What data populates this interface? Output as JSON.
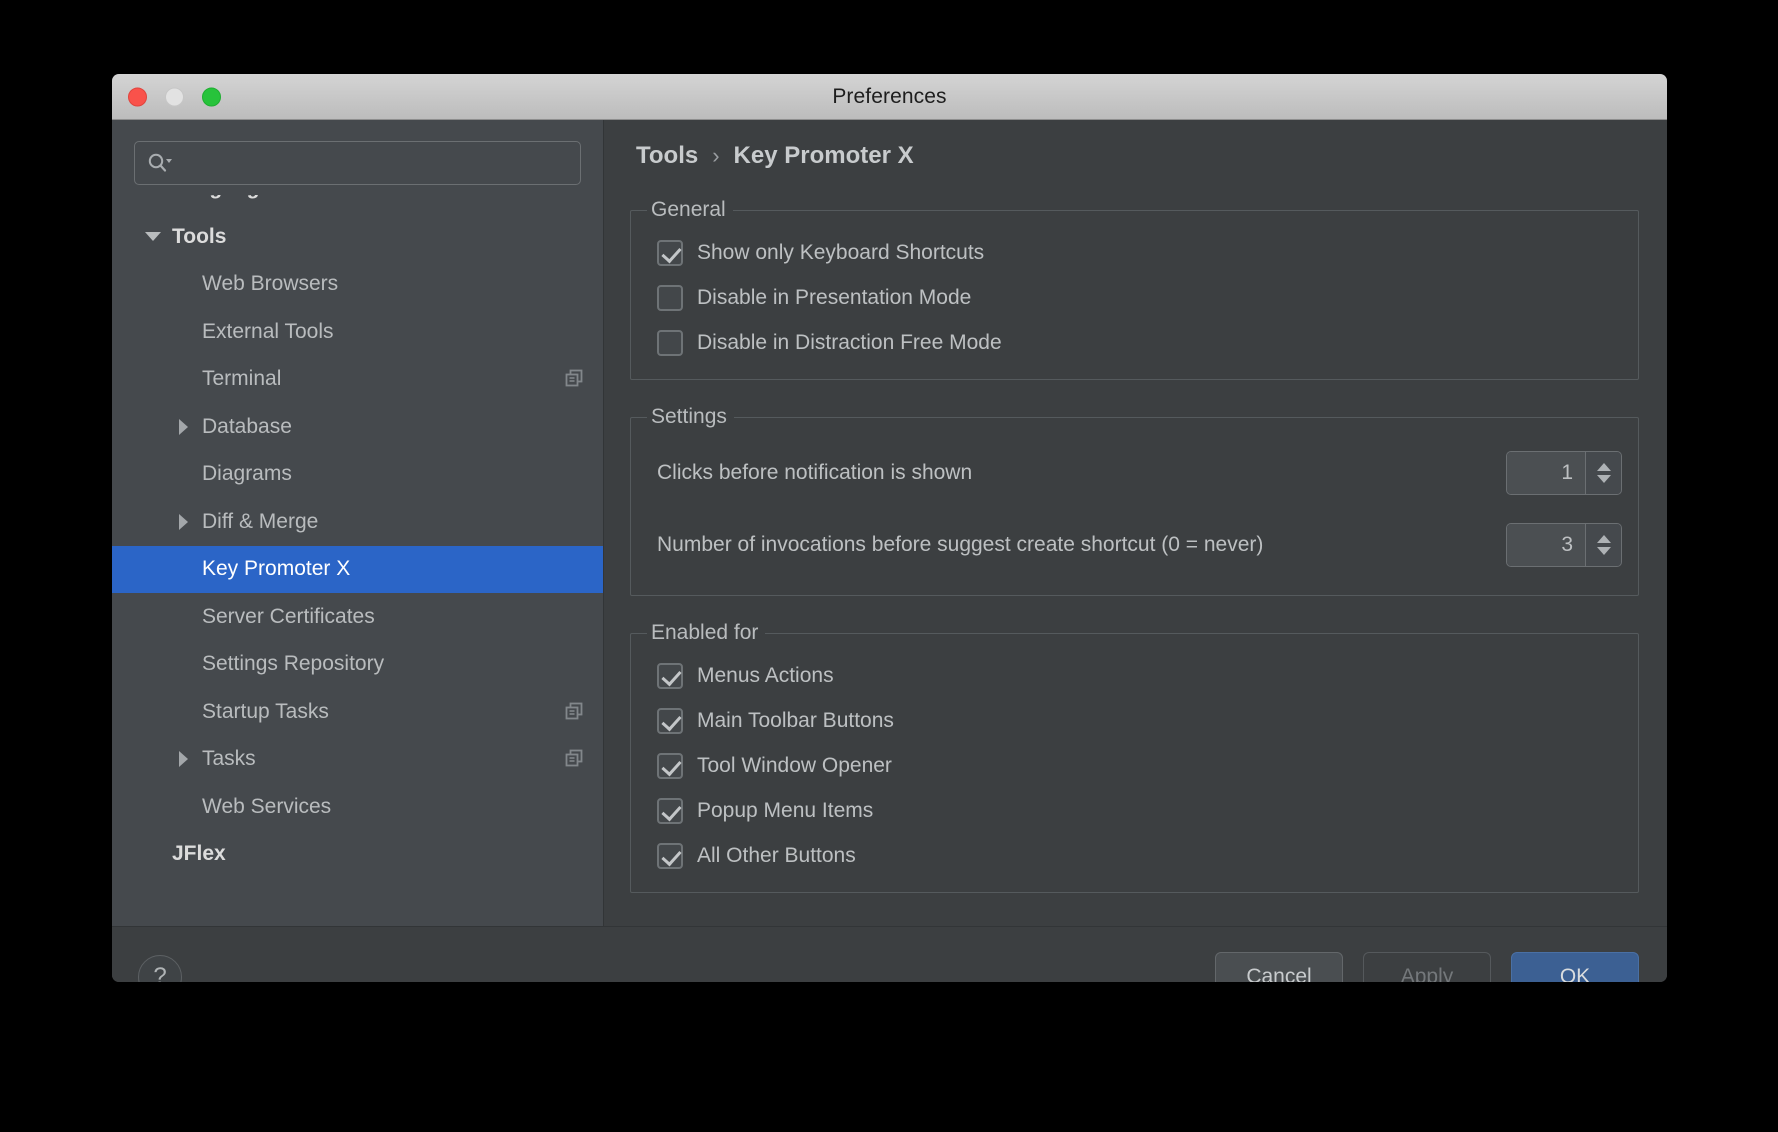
{
  "window": {
    "title": "Preferences",
    "traffic_lights": [
      "close-button",
      "minimize-button",
      "maximize-button"
    ]
  },
  "sidebar": {
    "search": {
      "value": "",
      "placeholder": "",
      "icon": "search-icon"
    },
    "items": [
      {
        "label": "Languages & Frameworks",
        "level": 0,
        "arrow": "none",
        "bold": true,
        "cut": true,
        "selected": false,
        "badge": ""
      },
      {
        "label": "Tools",
        "level": 0,
        "arrow": "down",
        "bold": true,
        "cut": false,
        "selected": false,
        "badge": ""
      },
      {
        "label": "Web Browsers",
        "level": 1,
        "arrow": "none",
        "bold": false,
        "cut": false,
        "selected": false,
        "badge": ""
      },
      {
        "label": "External Tools",
        "level": 1,
        "arrow": "none",
        "bold": false,
        "cut": false,
        "selected": false,
        "badge": ""
      },
      {
        "label": "Terminal",
        "level": 1,
        "arrow": "none",
        "bold": false,
        "cut": false,
        "selected": false,
        "badge": "copy-icon"
      },
      {
        "label": "Database",
        "level": 1,
        "arrow": "right",
        "bold": false,
        "cut": false,
        "selected": false,
        "badge": ""
      },
      {
        "label": "Diagrams",
        "level": 1,
        "arrow": "none",
        "bold": false,
        "cut": false,
        "selected": false,
        "badge": ""
      },
      {
        "label": "Diff & Merge",
        "level": 1,
        "arrow": "right",
        "bold": false,
        "cut": false,
        "selected": false,
        "badge": ""
      },
      {
        "label": "Key Promoter X",
        "level": 1,
        "arrow": "none",
        "bold": false,
        "cut": false,
        "selected": true,
        "badge": ""
      },
      {
        "label": "Server Certificates",
        "level": 1,
        "arrow": "none",
        "bold": false,
        "cut": false,
        "selected": false,
        "badge": ""
      },
      {
        "label": "Settings Repository",
        "level": 1,
        "arrow": "none",
        "bold": false,
        "cut": false,
        "selected": false,
        "badge": ""
      },
      {
        "label": "Startup Tasks",
        "level": 1,
        "arrow": "none",
        "bold": false,
        "cut": false,
        "selected": false,
        "badge": "copy-icon"
      },
      {
        "label": "Tasks",
        "level": 1,
        "arrow": "right",
        "bold": false,
        "cut": false,
        "selected": false,
        "badge": "copy-icon"
      },
      {
        "label": "Web Services",
        "level": 1,
        "arrow": "none",
        "bold": false,
        "cut": false,
        "selected": false,
        "badge": ""
      },
      {
        "label": "JFlex",
        "level": 0,
        "arrow": "none",
        "bold": true,
        "cut": false,
        "selected": false,
        "badge": ""
      }
    ]
  },
  "content": {
    "breadcrumb": {
      "parent": "Tools",
      "separator": "›",
      "current": "Key Promoter X"
    },
    "sections": [
      {
        "legend": "General",
        "kind": "checkboxes",
        "rows": [
          {
            "label": "Show only Keyboard Shortcuts",
            "checked": true
          },
          {
            "label": "Disable in Presentation Mode",
            "checked": false
          },
          {
            "label": "Disable in Distraction Free Mode",
            "checked": false
          }
        ]
      },
      {
        "legend": "Settings",
        "kind": "spinners",
        "rows": [
          {
            "label": "Clicks before notification is shown",
            "value": "1"
          },
          {
            "label": "Number of invocations before suggest create shortcut (0 = never)",
            "value": "3"
          }
        ]
      },
      {
        "legend": "Enabled for",
        "kind": "checkboxes",
        "rows": [
          {
            "label": "Menus Actions",
            "checked": true
          },
          {
            "label": "Main Toolbar Buttons",
            "checked": true
          },
          {
            "label": "Tool Window Opener",
            "checked": true
          },
          {
            "label": "Popup Menu Items",
            "checked": true
          },
          {
            "label": "All Other Buttons",
            "checked": true
          }
        ]
      }
    ]
  },
  "footer": {
    "help_label": "?",
    "cancel_label": "Cancel",
    "apply_label": "Apply",
    "ok_label": "OK",
    "apply_disabled": true
  },
  "colors": {
    "accent_selection": "#2b65c7",
    "ok_button": "#3c6093",
    "window_bg": "#3c3f41",
    "sidebar_bg": "#45494d",
    "titlebar_bg": "#c8c8c8",
    "text_primary": "#bdc0c2"
  }
}
